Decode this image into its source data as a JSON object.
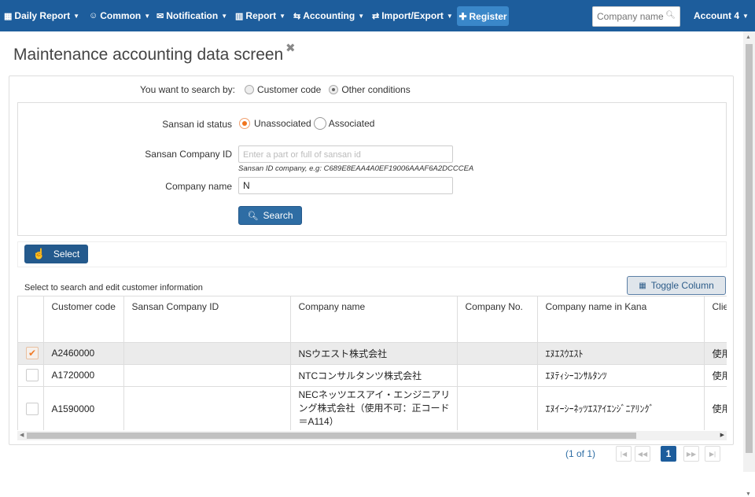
{
  "nav": {
    "items": [
      {
        "label": "Daily Report"
      },
      {
        "label": "Common"
      },
      {
        "label": "Notification"
      },
      {
        "label": "Report"
      },
      {
        "label": "Accounting"
      },
      {
        "label": "Import/Export"
      }
    ],
    "register_label": "Register",
    "search_placeholder": "Company name",
    "account_label": "Account 4"
  },
  "page": {
    "title": "Maintenance accounting data screen",
    "close_symbol": "✖"
  },
  "search_by": {
    "label": "You want to search by:",
    "options": [
      "Customer code",
      "Other conditions"
    ],
    "selected": "Other conditions"
  },
  "conditions": {
    "sansan_status_label": "Sansan id status",
    "sansan_status_options": [
      "Unassociated",
      "Associated"
    ],
    "sansan_status_selected": "Unassociated",
    "sansan_id_label": "Sansan Company ID",
    "sansan_id_placeholder": "Enter a part or full of sansan id",
    "sansan_id_value": "",
    "sansan_id_hint": "Sansan ID company, e.g: C689E8EAA4A0EF19006AAAF6A2DCCCEA",
    "company_name_label": "Company name",
    "company_name_value": "N",
    "search_button": "Search"
  },
  "select_button": "Select",
  "table": {
    "caption": "Select to search and edit customer information",
    "toggle_button": "Toggle Column",
    "columns": [
      "",
      "Customer code",
      "Sansan Company ID",
      "Company name",
      "Company No.",
      "Company name in Kana",
      "Clie"
    ],
    "rows": [
      {
        "checked": true,
        "code": "A2460000",
        "sansan_id": "",
        "company": "NSウエスト株式会社",
        "company_no": "",
        "kana": "ｴﾇｴｽｳｴｽﾄ",
        "client": "使用"
      },
      {
        "checked": false,
        "code": "A1720000",
        "sansan_id": "",
        "company": "NTCコンサルタンツ株式会社",
        "company_no": "",
        "kana": "ｴﾇﾃｨｼｰｺﾝｻﾙﾀﾝﾂ",
        "client": "使用"
      },
      {
        "checked": false,
        "code": "A1590000",
        "sansan_id": "",
        "company": "NECネッツエスアイ・エンジニアリング株式会社（使用不可：正コード＝A114）",
        "company_no": "",
        "kana": "ｴﾇｲｰｼｰﾈｯﾂｴｽｱｲｴﾝｼﾞﾆｱﾘﾝｸﾞ",
        "client": "使用"
      }
    ]
  },
  "pagination": {
    "summary": "(1 of 1)",
    "current_page": "1"
  },
  "colors": {
    "topbar": "#1d5d9c",
    "primary_button": "#2e6da4",
    "accent_orange": "#f0731c"
  }
}
